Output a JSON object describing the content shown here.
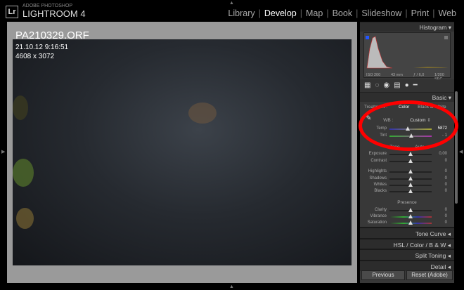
{
  "app": {
    "logo": "Lr",
    "vendor": "ADOBE PHOTOSHOP",
    "title": "LIGHTROOM 4"
  },
  "modules": [
    {
      "label": "Library"
    },
    {
      "label": "Develop",
      "active": true
    },
    {
      "label": "Map"
    },
    {
      "label": "Book"
    },
    {
      "label": "Slideshow"
    },
    {
      "label": "Print"
    },
    {
      "label": "Web"
    }
  ],
  "photo": {
    "filename": "PA210329.ORF",
    "datetime": "21.10.12 9:16:51",
    "dimensions": "4608 x 3072"
  },
  "histogram": {
    "title": "Histogram",
    "iso": "ISO 200",
    "focal": "43 mm",
    "aperture": "ƒ / 6,0",
    "shutter": "1/200 SEC"
  },
  "basic": {
    "title": "Basic",
    "treatment_label": "Treatment :",
    "treatment_color": "Color",
    "treatment_bw": "Black & White",
    "wb_label": "WB :",
    "wb_value": "Custom",
    "temp": {
      "label": "Temp",
      "value": "5872"
    },
    "tint": {
      "label": "Tint",
      "value": "- 1"
    },
    "tone_label": "Tone",
    "auto_label": "Auto",
    "sliders_tone": [
      {
        "label": "Exposure",
        "value": "0,00"
      },
      {
        "label": "Contrast",
        "value": "0"
      }
    ],
    "sliders_adj": [
      {
        "label": "Highlights",
        "value": "0"
      },
      {
        "label": "Shadows",
        "value": "0"
      },
      {
        "label": "Whites",
        "value": "0"
      },
      {
        "label": "Blacks",
        "value": "0"
      }
    ],
    "presence_label": "Presence",
    "sliders_presence": [
      {
        "label": "Clarity",
        "value": "0"
      },
      {
        "label": "Vibrance",
        "value": "0"
      },
      {
        "label": "Saturation",
        "value": "0"
      }
    ]
  },
  "sections": [
    {
      "label": "Tone Curve"
    },
    {
      "label": "HSL / Color / B & W"
    },
    {
      "label": "Split Toning"
    },
    {
      "label": "Detail"
    }
  ],
  "buttons": {
    "previous": "Previous",
    "reset": "Reset (Adobe)"
  },
  "annotation_color": "#ff0000"
}
